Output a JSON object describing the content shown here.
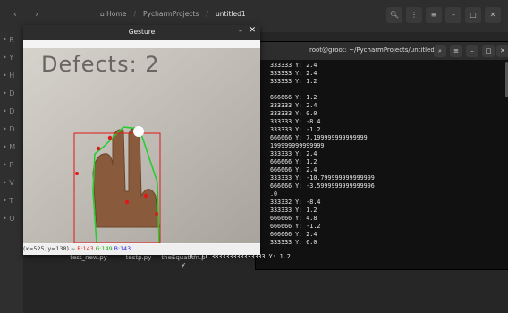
{
  "header": {
    "back_icon": "chevron-left-icon",
    "forward_icon": "chevron-right-icon",
    "home_label": "Home",
    "path_middle": "PycharmProjects",
    "path_current": "untitled1"
  },
  "sidebar": {
    "letters": [
      "R",
      "Y",
      "H",
      "D",
      "D",
      "D",
      "M",
      "P",
      "V",
      "T",
      "O"
    ]
  },
  "terminal": {
    "title": "root@groot: ~/PycharmProjects/untitled1",
    "lines": [
      "333333 Y: 2.4",
      "333333 Y: 2.4",
      "333333 Y: 1.2",
      "",
      "666666 Y: 1.2",
      "333333 Y: 2.4",
      "333333 Y: 0.0",
      "333333 Y: -8.4",
      "333333 Y: -1.2",
      "666666 Y: 7.199999999999999",
      "199999999999999",
      "333333 Y: 2.4",
      "666666 Y: 1.2",
      "666666 Y: 2.4",
      "333333 Y: -10.799999999999999",
      "666666 Y: -3.5999999999999996",
      ".0",
      "333332 Y: -8.4",
      "333333 Y: 1.2",
      "666666 Y: 4.8",
      "666666 Y: -1.2",
      "666666 Y: 2.4",
      "333333 Y: 6.0"
    ],
    "last_line": "X: 11.383333333333333 Y: 1.2"
  },
  "files": [
    {
      "label": "test_new.py"
    },
    {
      "label": "testp.py"
    },
    {
      "label": "theEquation.py"
    }
  ],
  "gesture": {
    "title": "Gesture",
    "defects_text": "Defects: 2",
    "status_pos": "(x=525, y=138) ~",
    "status_r": "R:143",
    "status_g": "G:149",
    "status_b": "B:143"
  }
}
